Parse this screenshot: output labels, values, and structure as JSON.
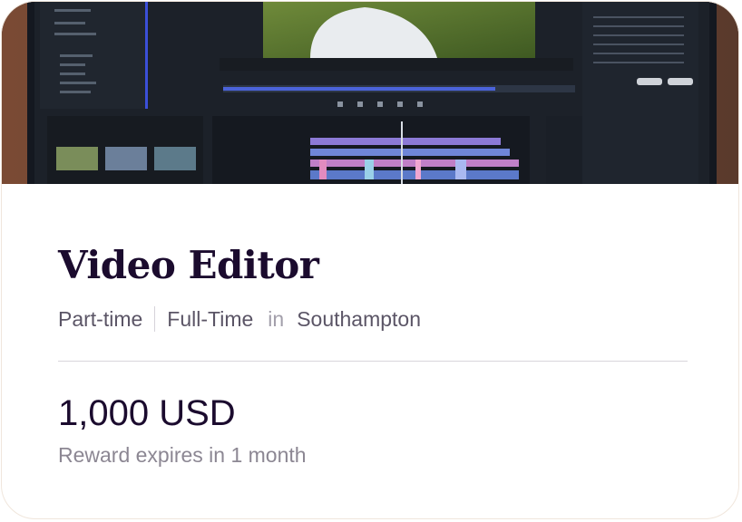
{
  "hero_image": {
    "description_icon": "video-editing-software-photo"
  },
  "job": {
    "title": "Video Editor",
    "employment_type_1": "Part-time",
    "employment_type_2": "Full-Time",
    "location_prefix": "in",
    "location": "Southampton"
  },
  "reward": {
    "amount": "1,000 USD",
    "expiry": "Reward expires in 1 month"
  },
  "colors": {
    "title": "#1b0b2e",
    "meta": "#5b5566",
    "muted": "#8c8793",
    "card_border": "#f0e6dc"
  }
}
